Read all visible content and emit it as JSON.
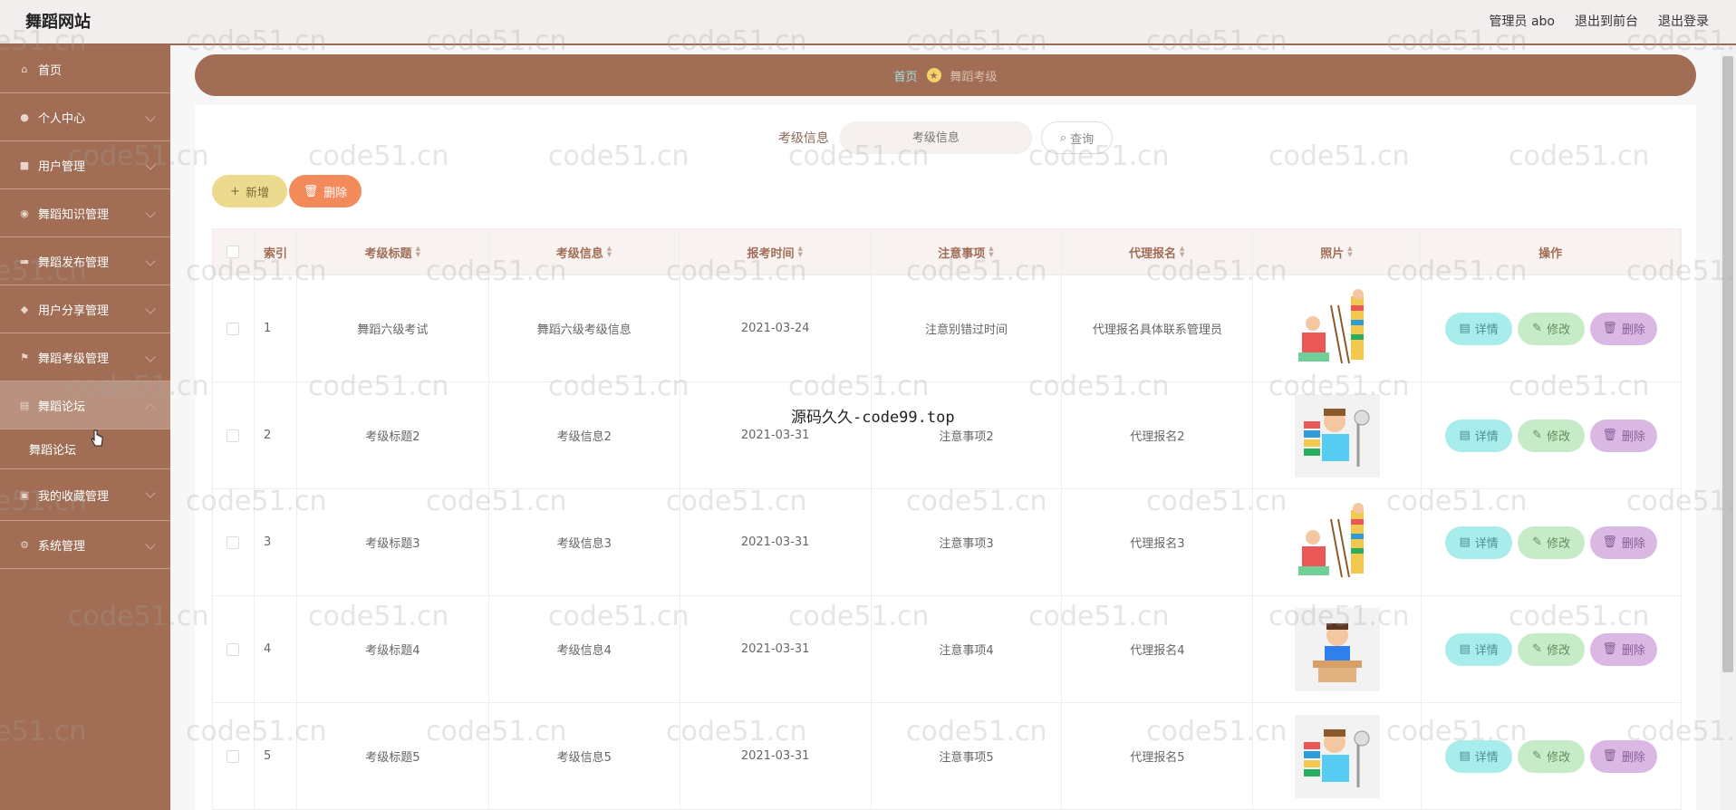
{
  "header": {
    "brand": "舞蹈网站",
    "user": "管理员 abo",
    "front": "退出到前台",
    "logout": "退出登录"
  },
  "sidebar": {
    "items": [
      {
        "label": "首页",
        "icon": "home-icon"
      },
      {
        "label": "个人中心",
        "icon": "user-icon"
      },
      {
        "label": "用户管理",
        "icon": "users-icon"
      },
      {
        "label": "舞蹈知识管理",
        "icon": "book-icon"
      },
      {
        "label": "舞蹈发布管理",
        "icon": "publish-icon"
      },
      {
        "label": "用户分享管理",
        "icon": "share-icon"
      },
      {
        "label": "舞蹈考级管理",
        "icon": "flag-icon"
      },
      {
        "label": "舞蹈论坛",
        "icon": "forum-icon"
      },
      {
        "label": "我的收藏管理",
        "icon": "star-icon"
      },
      {
        "label": "系统管理",
        "icon": "gear-icon"
      }
    ],
    "sub": "舞蹈论坛"
  },
  "breadcrumb": {
    "home": "首页",
    "current": "舞蹈考级"
  },
  "search": {
    "label": "考级信息",
    "placeholder": "考级信息",
    "button": "查询"
  },
  "actions": {
    "add": "新增",
    "delete": "删除"
  },
  "table": {
    "headers": [
      "索引",
      "考级标题",
      "考级信息",
      "报考时间",
      "注意事项",
      "代理报名",
      "照片",
      "操作"
    ],
    "rows": [
      {
        "index": "1",
        "title": "舞蹈六级考试",
        "info": "舞蹈六级考级信息",
        "date": "2021-03-24",
        "notes": "注意别错过时间",
        "agent": "代理报名具体联系管理员"
      },
      {
        "index": "2",
        "title": "考级标题2",
        "info": "考级信息2",
        "date": "2021-03-31",
        "notes": "注意事项2",
        "agent": "代理报名2"
      },
      {
        "index": "3",
        "title": "考级标题3",
        "info": "考级信息3",
        "date": "2021-03-31",
        "notes": "注意事项3",
        "agent": "代理报名3"
      },
      {
        "index": "4",
        "title": "考级标题4",
        "info": "考级信息4",
        "date": "2021-03-31",
        "notes": "注意事项4",
        "agent": "代理报名4"
      },
      {
        "index": "5",
        "title": "考级标题5",
        "info": "考级信息5",
        "date": "2021-03-31",
        "notes": "注意事项5",
        "agent": "代理报名5"
      }
    ],
    "ops": {
      "detail": "详情",
      "edit": "修改",
      "delete": "删除"
    }
  },
  "overlay_text": "源码久久-code99.top",
  "watermark": "code51.cn",
  "colors": {
    "sidebar": "#a16e55",
    "accent": "#9de3e4",
    "add": "#ecdb8e",
    "delete": "#f28a5a"
  }
}
